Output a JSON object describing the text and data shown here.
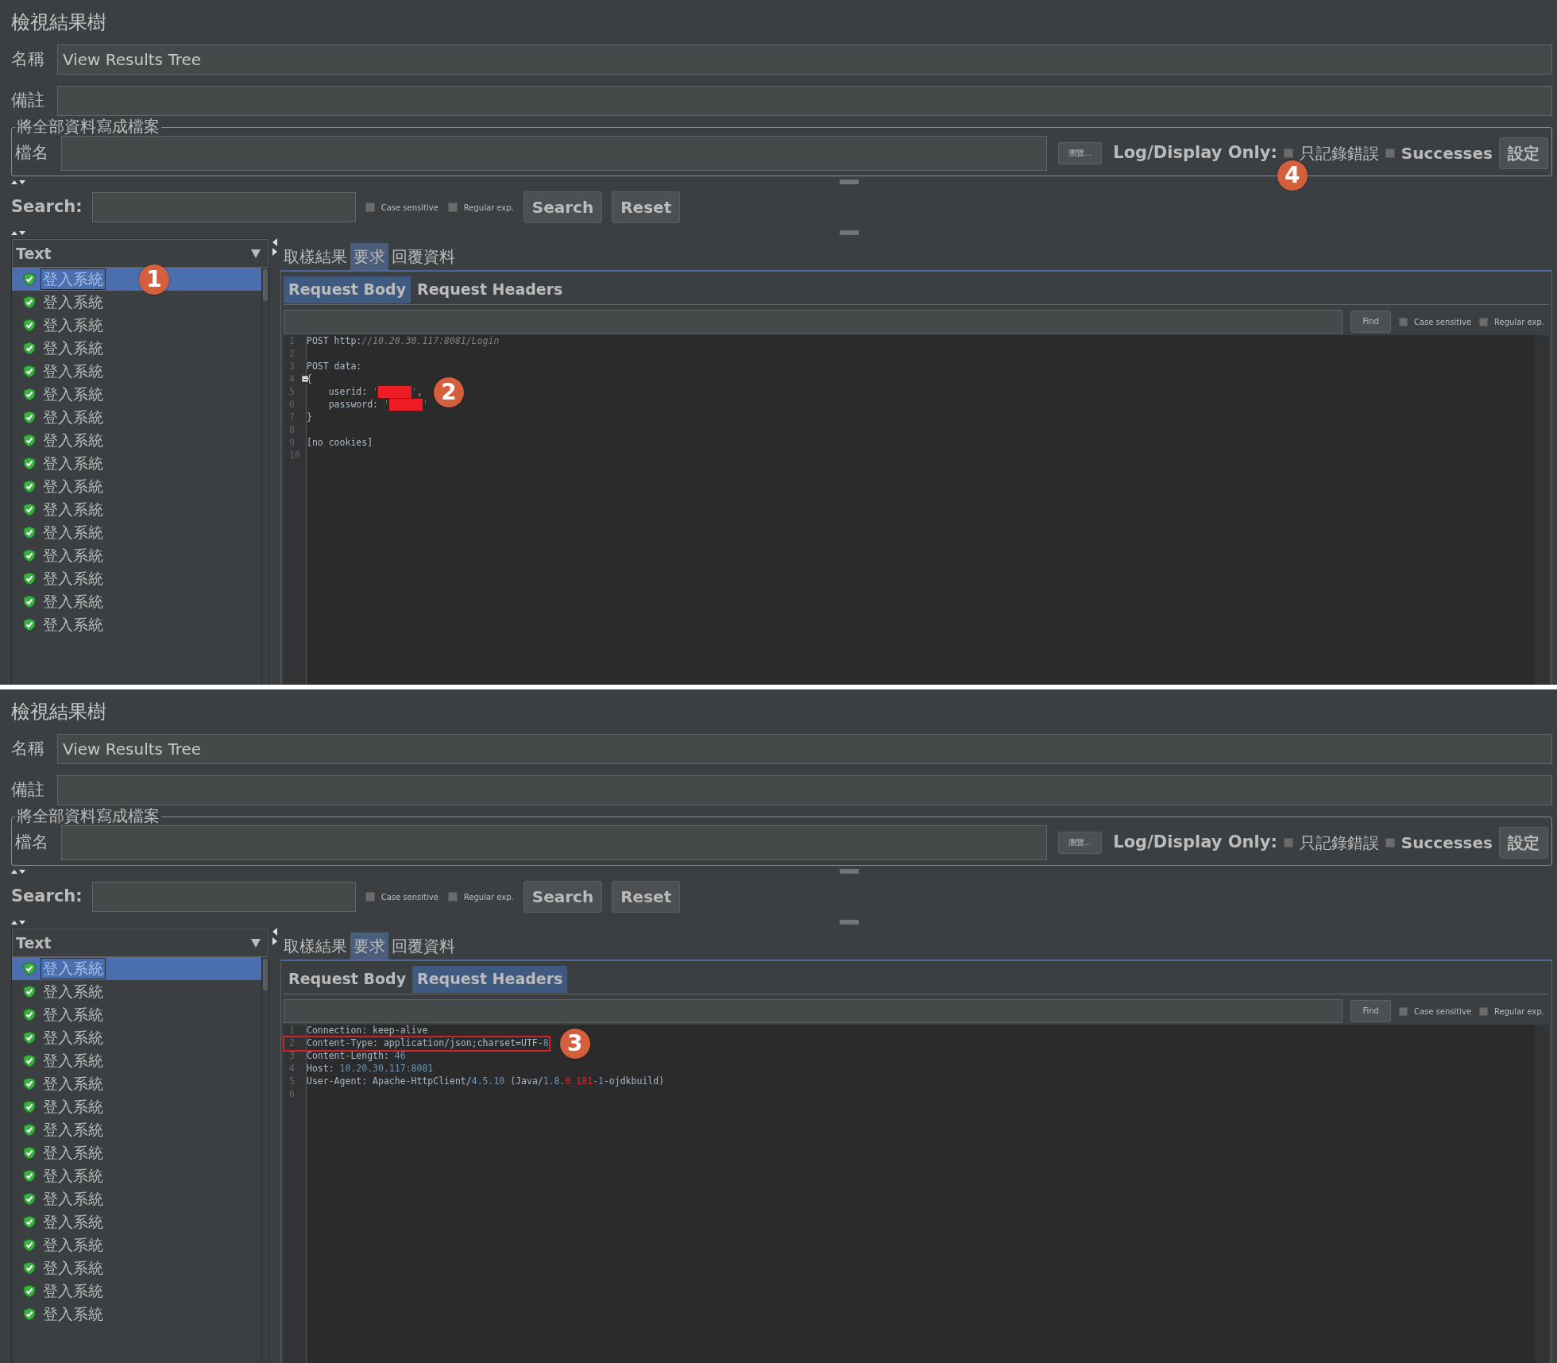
{
  "panels": [
    {
      "title": "檢視結果樹",
      "name_field": {
        "label": "名稱",
        "value": "View Results Tree"
      },
      "comment_field": {
        "label": "備註"
      },
      "file_group": {
        "legend": "將全部資料寫成檔案",
        "label": "檔名",
        "browse": "瀏覽...",
        "log_label": "Log/Display Only:",
        "errors": {
          "label": "只記錄錯誤",
          "checked": false,
          "callout": "4"
        },
        "successes": {
          "label": "Successes",
          "checked": false
        },
        "configure": "設定"
      },
      "search": {
        "label": "Search:",
        "case_sensitive": {
          "label": "Case sensitive",
          "checked": false
        },
        "regex": {
          "label": "Regular exp.",
          "checked": false
        },
        "search_button": "Search",
        "reset_button": "Reset"
      },
      "tree": {
        "renderer": "Text",
        "items": [
          {
            "label": "登入系統",
            "selected": true,
            "callout": "1"
          },
          {
            "label": "登入系統",
            "selected": false
          },
          {
            "label": "登入系統",
            "selected": false
          },
          {
            "label": "登入系統",
            "selected": false
          },
          {
            "label": "登入系統",
            "selected": false
          },
          {
            "label": "登入系統",
            "selected": false
          },
          {
            "label": "登入系統",
            "selected": false
          },
          {
            "label": "登入系統",
            "selected": false
          },
          {
            "label": "登入系統",
            "selected": false
          },
          {
            "label": "登入系統",
            "selected": false
          },
          {
            "label": "登入系統",
            "selected": false
          },
          {
            "label": "登入系統",
            "selected": false
          },
          {
            "label": "登入系統",
            "selected": false
          },
          {
            "label": "登入系統",
            "selected": false
          },
          {
            "label": "登入系統",
            "selected": false
          },
          {
            "label": "登入系統",
            "selected": false
          }
        ]
      },
      "tabs": [
        {
          "label": "取樣結果",
          "selected": false
        },
        {
          "label": "要求",
          "selected": true
        },
        {
          "label": "回覆資料",
          "selected": false
        }
      ],
      "subtabs": [
        {
          "label": "Request Body",
          "selected": true
        },
        {
          "label": "Request Headers",
          "selected": false
        }
      ],
      "find": {
        "button": "Find",
        "case_sensitive": {
          "label": "Case sensitive",
          "checked": false
        },
        "regex": {
          "label": "Regular exp.",
          "checked": false
        }
      },
      "code": [
        {
          "number": "1",
          "foldable": false,
          "highlighted": false,
          "segments": [
            {
              "kind": "plain",
              "text": "POST http:"
            },
            {
              "kind": "comment",
              "text": "//10.20.30.117:8081/Login"
            }
          ]
        },
        {
          "number": "2",
          "foldable": false,
          "highlighted": false
        },
        {
          "number": "3",
          "foldable": false,
          "highlighted": false,
          "segments": [
            {
              "kind": "plain",
              "text": "POST data:"
            }
          ]
        },
        {
          "number": "4",
          "foldable": true,
          "highlighted": false,
          "segments": [
            {
              "kind": "plain",
              "text": "{"
            }
          ]
        },
        {
          "number": "5",
          "foldable": false,
          "highlighted": false,
          "callout": "2",
          "segments": [
            {
              "kind": "plain",
              "text": "    userid: "
            },
            {
              "kind": "string",
              "text": "'"
            },
            {
              "kind": "redacted"
            },
            {
              "kind": "string",
              "text": "'"
            },
            {
              "kind": "plain",
              "text": ","
            }
          ]
        },
        {
          "number": "6",
          "foldable": false,
          "highlighted": false,
          "segments": [
            {
              "kind": "plain",
              "text": "    password: "
            },
            {
              "kind": "string",
              "text": "'"
            },
            {
              "kind": "redacted"
            },
            {
              "kind": "string",
              "text": "'"
            }
          ]
        },
        {
          "number": "7",
          "foldable": false,
          "highlighted": false,
          "segments": [
            {
              "kind": "plain",
              "text": "}"
            }
          ]
        },
        {
          "number": "8",
          "foldable": false,
          "highlighted": false
        },
        {
          "number": "9",
          "foldable": false,
          "highlighted": false,
          "segments": [
            {
              "kind": "plain",
              "text": "[no cookies]"
            }
          ]
        },
        {
          "number": "10",
          "foldable": false,
          "highlighted": false
        }
      ]
    },
    {
      "title": "檢視結果樹",
      "name_field": {
        "label": "名稱",
        "value": "View Results Tree"
      },
      "comment_field": {
        "label": "備註"
      },
      "file_group": {
        "legend": "將全部資料寫成檔案",
        "label": "檔名",
        "browse": "瀏覽...",
        "log_label": "Log/Display Only:",
        "errors": {
          "label": "只記錄錯誤",
          "checked": false
        },
        "successes": {
          "label": "Successes",
          "checked": false
        },
        "configure": "設定"
      },
      "search": {
        "label": "Search:",
        "case_sensitive": {
          "label": "Case sensitive",
          "checked": false
        },
        "regex": {
          "label": "Regular exp.",
          "checked": false
        },
        "search_button": "Search",
        "reset_button": "Reset"
      },
      "tree": {
        "renderer": "Text",
        "items": [
          {
            "label": "登入系統",
            "selected": true
          },
          {
            "label": "登入系統",
            "selected": false
          },
          {
            "label": "登入系統",
            "selected": false
          },
          {
            "label": "登入系統",
            "selected": false
          },
          {
            "label": "登入系統",
            "selected": false
          },
          {
            "label": "登入系統",
            "selected": false
          },
          {
            "label": "登入系統",
            "selected": false
          },
          {
            "label": "登入系統",
            "selected": false
          },
          {
            "label": "登入系統",
            "selected": false
          },
          {
            "label": "登入系統",
            "selected": false
          },
          {
            "label": "登入系統",
            "selected": false
          },
          {
            "label": "登入系統",
            "selected": false
          },
          {
            "label": "登入系統",
            "selected": false
          },
          {
            "label": "登入系統",
            "selected": false
          },
          {
            "label": "登入系統",
            "selected": false
          },
          {
            "label": "登入系統",
            "selected": false
          }
        ]
      },
      "tabs": [
        {
          "label": "取樣結果",
          "selected": false
        },
        {
          "label": "要求",
          "selected": true
        },
        {
          "label": "回覆資料",
          "selected": false
        }
      ],
      "subtabs": [
        {
          "label": "Request Body",
          "selected": false
        },
        {
          "label": "Request Headers",
          "selected": true
        }
      ],
      "find": {
        "button": "Find",
        "case_sensitive": {
          "label": "Case sensitive",
          "checked": false
        },
        "regex": {
          "label": "Regular exp.",
          "checked": false
        }
      },
      "code": [
        {
          "number": "1",
          "foldable": false,
          "highlighted": false,
          "segments": [
            {
              "kind": "plain",
              "text": "Connection: keep-alive"
            }
          ]
        },
        {
          "number": "2",
          "foldable": false,
          "highlighted": true,
          "callout": "3",
          "segments": [
            {
              "kind": "plain",
              "text": "Content-Type: application/json;charset=UTF-"
            },
            {
              "kind": "number",
              "text": "8"
            }
          ]
        },
        {
          "number": "3",
          "foldable": false,
          "highlighted": false,
          "segments": [
            {
              "kind": "plain",
              "text": "Content-Length: "
            },
            {
              "kind": "number",
              "text": "46"
            }
          ]
        },
        {
          "number": "4",
          "foldable": false,
          "highlighted": false,
          "segments": [
            {
              "kind": "plain",
              "text": "Host: "
            },
            {
              "kind": "number",
              "text": "10.20.30.117:8081"
            }
          ]
        },
        {
          "number": "5",
          "foldable": false,
          "highlighted": false,
          "segments": [
            {
              "kind": "plain",
              "text": "User-Agent: Apache-HttpClient/"
            },
            {
              "kind": "number",
              "text": "4.5.10"
            },
            {
              "kind": "plain",
              "text": " (Java/"
            },
            {
              "kind": "number",
              "text": "1.8."
            },
            {
              "kind": "error",
              "text": "0_181"
            },
            {
              "kind": "number",
              "text": "-1"
            },
            {
              "kind": "plain",
              "text": "-ojdkbuild)"
            }
          ]
        },
        {
          "number": "6",
          "foldable": false,
          "highlighted": false
        }
      ]
    }
  ]
}
